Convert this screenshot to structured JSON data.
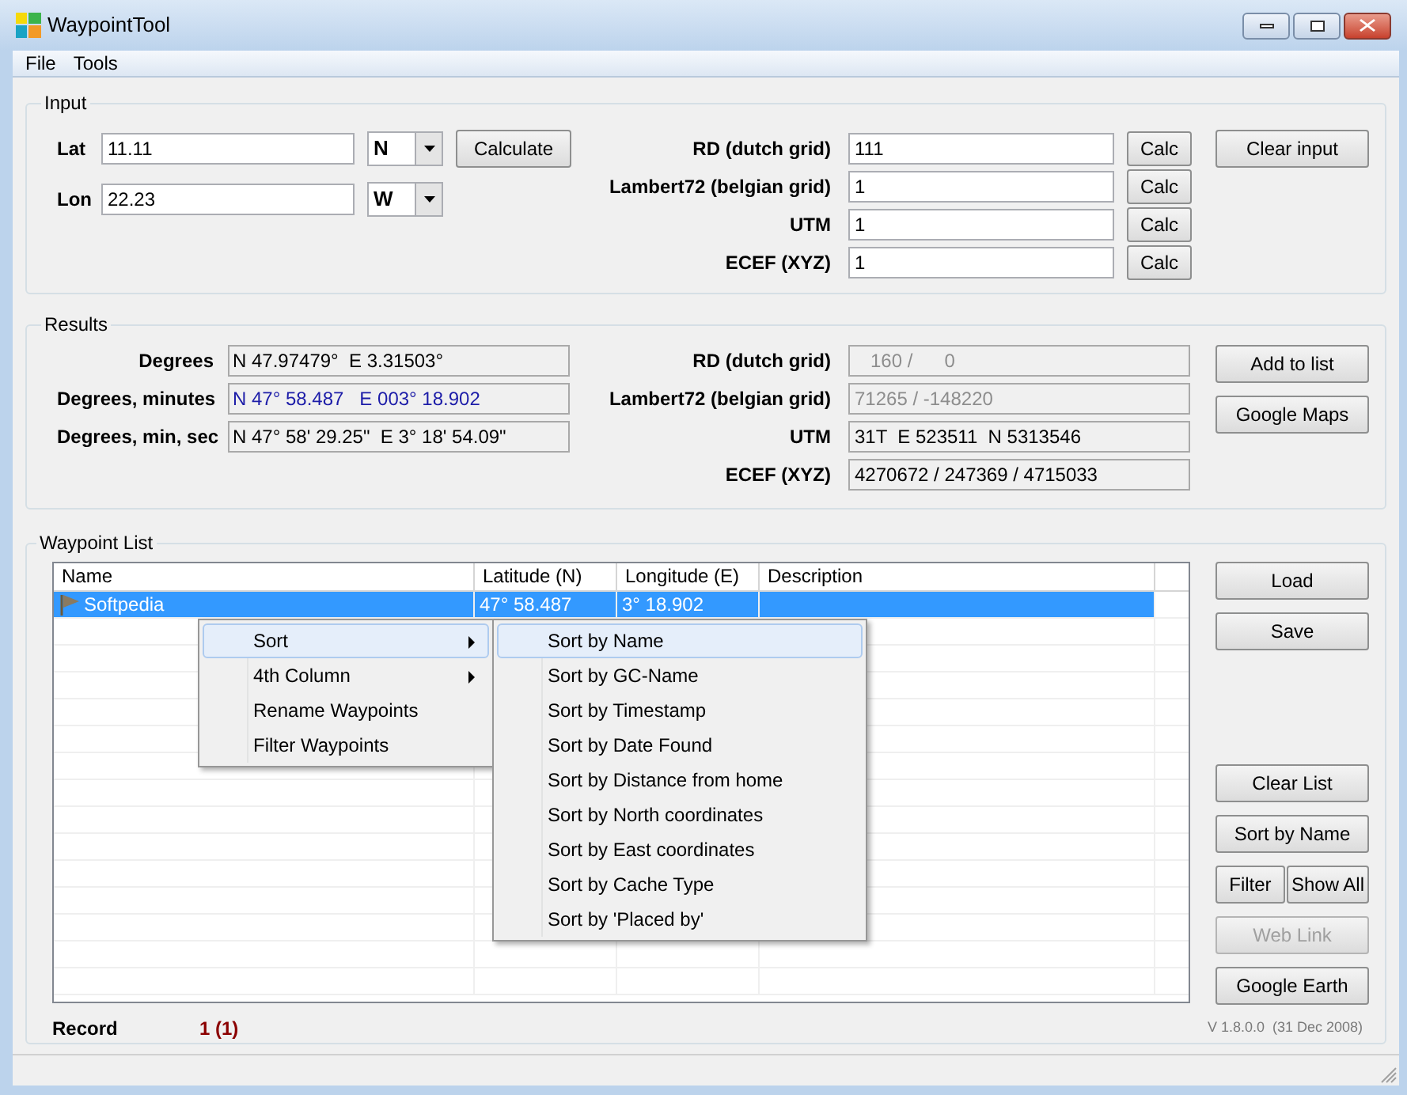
{
  "window": {
    "title": "WaypointTool"
  },
  "menu_bar": [
    {
      "label": "File"
    },
    {
      "label": "Tools"
    }
  ],
  "input": {
    "title": "Input",
    "coordinates": [
      {
        "label": "Lat",
        "value": "11.11",
        "hemisphere": "N"
      },
      {
        "label": "Lon",
        "value": "22.23",
        "hemisphere": "W"
      }
    ],
    "calculate_button": "Calculate",
    "grids": [
      {
        "label": "RD (dutch grid)",
        "value": "111",
        "button": "Calc"
      },
      {
        "label": "Lambert72 (belgian grid)",
        "value": "1",
        "button": "Calc"
      },
      {
        "label": "UTM",
        "value": "1",
        "button": "Calc"
      },
      {
        "label": "ECEF (XYZ)",
        "value": "1",
        "button": "Calc"
      }
    ],
    "clear_button": "Clear input"
  },
  "results": {
    "title": "Results",
    "geo": [
      {
        "label": "Degrees",
        "value": "N 47.97479°  E 3.31503°",
        "highlighted": false
      },
      {
        "label": "Degrees, minutes",
        "value": "N 47° 58.487   E 003° 18.902",
        "highlighted": true
      },
      {
        "label": "Degrees, min, sec",
        "value": "N 47° 58' 29.25\"  E 3° 18' 54.09\"",
        "highlighted": false
      }
    ],
    "grids": [
      {
        "label": "RD (dutch grid)",
        "value": "   160 /      0",
        "disabled": true
      },
      {
        "label": "Lambert72 (belgian grid)",
        "value": "71265 / -148220",
        "disabled": true
      },
      {
        "label": "UTM",
        "value": "31T  E 523511  N 5313546",
        "disabled": false
      },
      {
        "label": "ECEF (XYZ)",
        "value": "4270672 / 247369 / 4715033",
        "disabled": false
      }
    ],
    "buttons": [
      {
        "label": "Add to list"
      },
      {
        "label": "Google Maps"
      }
    ]
  },
  "waypoint_list": {
    "title": "Waypoint List",
    "columns": [
      "Name",
      "Latitude (N)",
      "Longitude (E)",
      "Description"
    ],
    "rows": [
      {
        "name": "Softpedia",
        "latitude": "47° 58.487",
        "longitude": "3° 18.902",
        "selected": true
      }
    ],
    "top_buttons": [
      {
        "label": "Load",
        "disabled": false
      },
      {
        "label": "Save",
        "disabled": false
      }
    ],
    "bottom_buttons": [
      {
        "label": "Clear List",
        "kind": "wide",
        "disabled": false
      },
      {
        "label": "Sort by Name",
        "kind": "wide",
        "disabled": false
      },
      {
        "label": "Filter",
        "kind": "half",
        "disabled": false
      },
      {
        "label": "Show All",
        "kind": "half",
        "disabled": false
      },
      {
        "label": "Web Link",
        "kind": "wide",
        "disabled": true
      },
      {
        "label": "Google Earth",
        "kind": "wide",
        "disabled": false
      }
    ],
    "record": {
      "label": "Record",
      "value": "1 (1)"
    },
    "version": "V 1.8.0.0  (31 Dec 2008)"
  },
  "context_menu": {
    "items": [
      {
        "label": "Sort",
        "selected": true,
        "submenu": true
      },
      {
        "label": "4th Column",
        "selected": false,
        "submenu": true
      },
      {
        "label": "Rename Waypoints",
        "selected": false,
        "submenu": false
      },
      {
        "label": "Filter Waypoints",
        "selected": false,
        "submenu": false
      }
    ]
  },
  "submenu": {
    "items": [
      {
        "label": "Sort by Name",
        "selected": true
      },
      {
        "label": "Sort by GC-Name",
        "selected": false
      },
      {
        "label": "Sort by Timestamp",
        "selected": false
      },
      {
        "label": "Sort by Date Found",
        "selected": false
      },
      {
        "label": "Sort by Distance from home",
        "selected": false
      },
      {
        "label": "Sort by North coordinates",
        "selected": false
      },
      {
        "label": "Sort by East coordinates",
        "selected": false
      },
      {
        "label": "Sort by Cache Type",
        "selected": false
      },
      {
        "label": "Sort by 'Placed by'",
        "selected": false
      }
    ]
  }
}
